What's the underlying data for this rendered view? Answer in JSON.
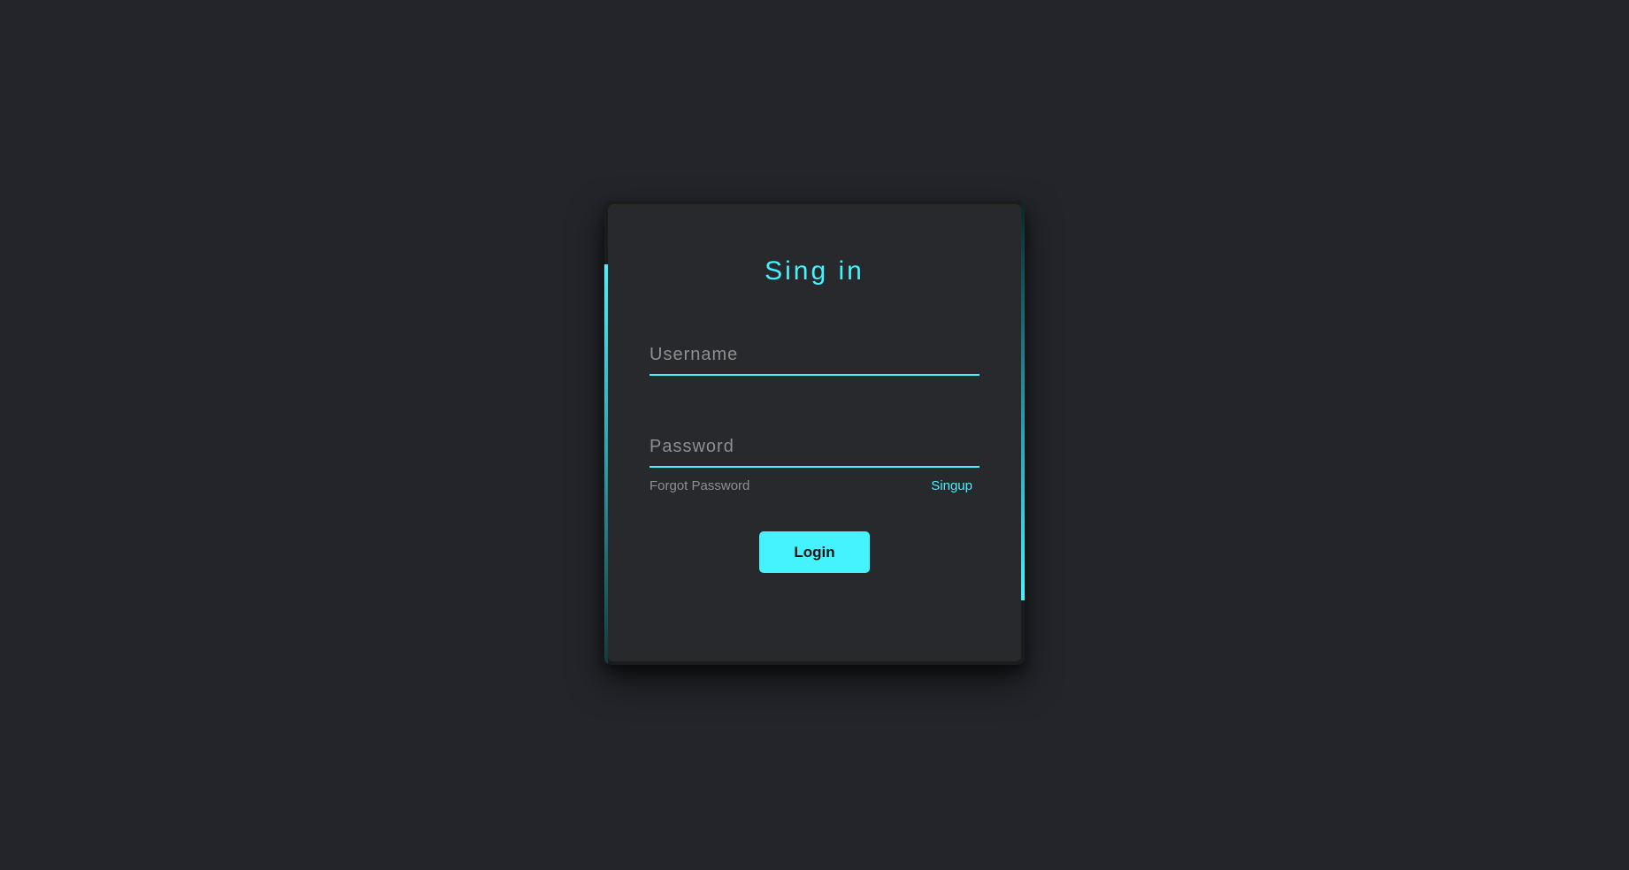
{
  "form": {
    "title": "Sing in",
    "username": {
      "placeholder": "Username",
      "value": ""
    },
    "password": {
      "placeholder": "Password",
      "value": ""
    },
    "links": {
      "forgot_password": "Forgot Password",
      "signup": "Singup"
    },
    "login_button": "Login"
  },
  "colors": {
    "background": "#23252a",
    "card": "#28292d",
    "accent": "#45f3ff",
    "muted_text": "#8f8f8f"
  }
}
